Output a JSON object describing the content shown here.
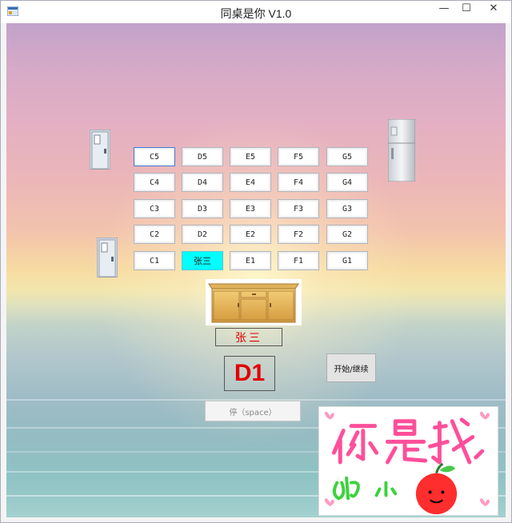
{
  "window": {
    "title": "同桌是你 V1.0",
    "controls": {
      "minimize": "—",
      "maximize": "☐",
      "close": "✕"
    }
  },
  "seat_grid": {
    "rows": [
      [
        "C5",
        "D5",
        "E5",
        "F5",
        "G5"
      ],
      [
        "C4",
        "D4",
        "E4",
        "F4",
        "G4"
      ],
      [
        "C3",
        "D3",
        "E3",
        "F3",
        "G3"
      ],
      [
        "C2",
        "D2",
        "E2",
        "F2",
        "G2"
      ],
      [
        "C1",
        "张三",
        "E1",
        "F1",
        "G1"
      ]
    ],
    "highlighted_seat": "张三",
    "highlight_color": "#00ffff"
  },
  "result": {
    "name": "张三",
    "seat_code": "D1",
    "text_color": "#e20000"
  },
  "buttons": {
    "start_continue": "开始/继续",
    "stop": "停（space）"
  },
  "icons": {
    "door": "door-icon",
    "fridge": "fridge-icon",
    "desk": "teacher-desk-image",
    "sticker": "sticker-image"
  }
}
